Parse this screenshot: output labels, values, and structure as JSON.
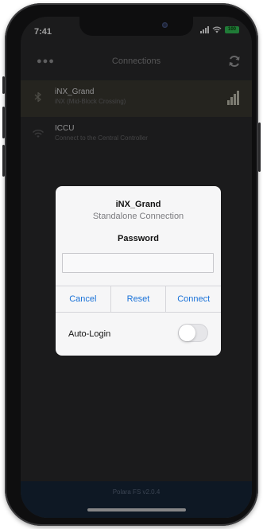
{
  "status_bar": {
    "time": "7:41",
    "battery": "100"
  },
  "nav": {
    "menu_icon": "more-dots-icon",
    "title": "Connections",
    "refresh_icon": "refresh-icon"
  },
  "connections": [
    {
      "icon": "bluetooth-icon",
      "name": "iNX_Grand",
      "subtitle": "iNX (Mid-Block Crossing)",
      "signal_icon": "signal-strength-icon",
      "selected": true
    },
    {
      "icon": "wifi-icon",
      "name": "ICCU",
      "subtitle": "Connect to the Central Controller",
      "selected": false
    }
  ],
  "dialog": {
    "title": "iNX_Grand",
    "subtitle": "Standalone Connection",
    "password_label": "Password",
    "password_value": "",
    "buttons": {
      "cancel": "Cancel",
      "reset": "Reset",
      "connect": "Connect"
    },
    "auto_login_label": "Auto-Login",
    "auto_login_enabled": false
  },
  "footer": {
    "version": "Polara FS v2.0.4"
  },
  "colors": {
    "accent": "#1a72d8",
    "footer_bg": "#18273a",
    "battery": "#34c759"
  }
}
